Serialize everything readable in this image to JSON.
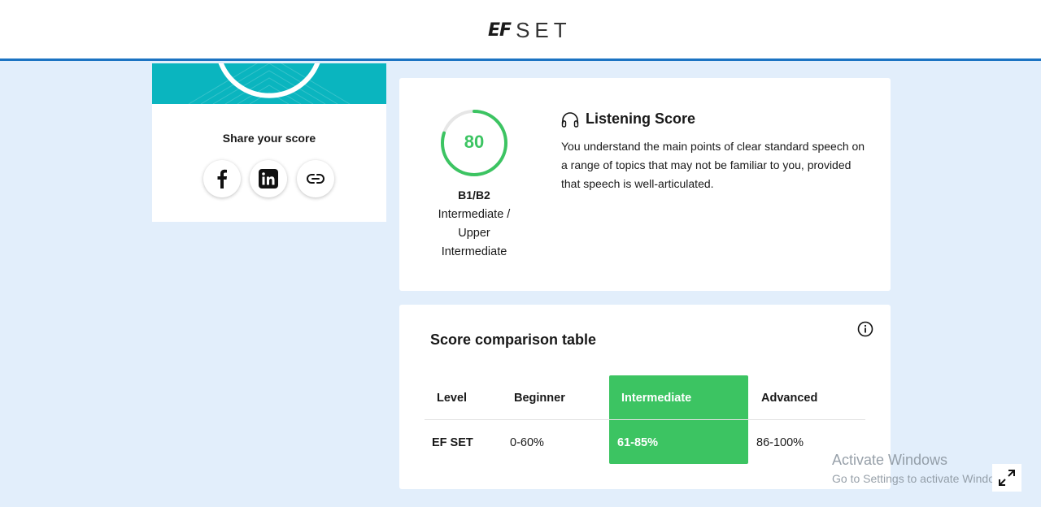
{
  "header": {
    "logo_ef": "EF",
    "logo_set": "SET"
  },
  "share": {
    "title": "Share your score",
    "buttons": [
      {
        "name": "facebook",
        "icon": "facebook-icon"
      },
      {
        "name": "linkedin",
        "icon": "linkedin-icon"
      },
      {
        "name": "copy-link",
        "icon": "link-icon"
      }
    ]
  },
  "listening": {
    "score": "80",
    "score_fraction": 0.8,
    "level_code": "B1/B2",
    "level_name_lines": [
      "Intermediate /",
      "Upper",
      "Intermediate"
    ],
    "title": "Listening Score",
    "icon": "headphones-icon",
    "description": "You understand the main points of clear standard speech on a range of topics that may not be familiar to you, provided that speech is well-articulated."
  },
  "comparison": {
    "title": "Score comparison table",
    "info_icon": "info-icon",
    "headers": [
      "Level",
      "Beginner",
      "Intermediate",
      "Advanced"
    ],
    "row": [
      "EF SET",
      "0-60%",
      "61-85%",
      "86-100%"
    ],
    "highlight_color": "#3cc462"
  },
  "watermark": {
    "line1": "Activate Windows",
    "line2": "Go to Settings to activate Windows."
  },
  "colors": {
    "accent": "#1b73c2",
    "teal": "#0ab5bf",
    "green": "#3cc462",
    "background": "#e2eefb"
  }
}
